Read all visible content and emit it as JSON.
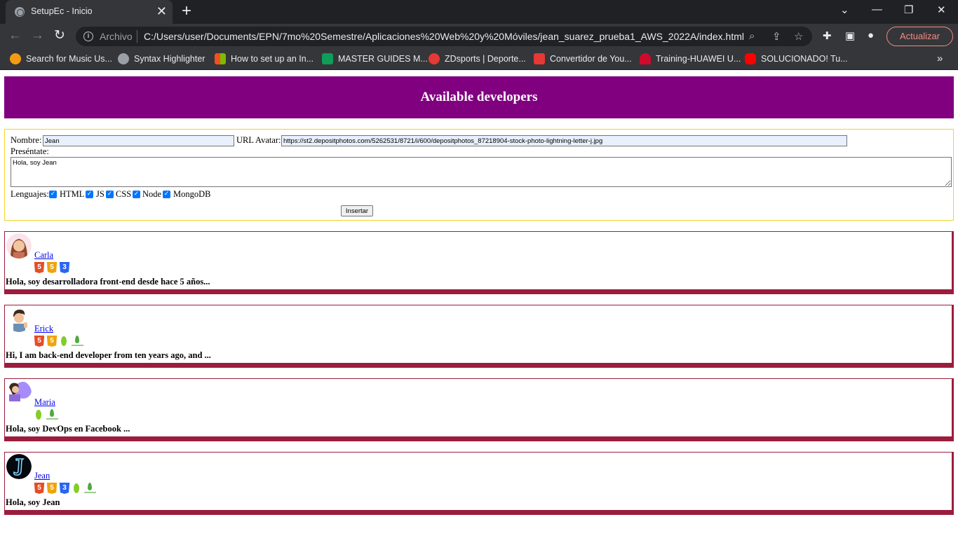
{
  "browser": {
    "tab_title": "SetupEc - Inicio",
    "tab_close": "✕",
    "new_tab": "+",
    "window_controls": {
      "dropdown": "⌄",
      "minimize": "—",
      "restore": "❐",
      "close": "✕"
    },
    "nav": {
      "back": "←",
      "forward": "→",
      "reload": "↻"
    },
    "omnibox": {
      "scheme_label": "Archivo",
      "url": "C:/Users/user/Documents/EPN/7mo%20Semestre/Aplicaciones%20Web%20y%20Móviles/jean_suarez_prueba1_AWS_2022A/index.html"
    },
    "update_button": "Actualizar",
    "bookmarks": [
      {
        "label": "Search for Music Us...",
        "icon": "music-search-icon",
        "color": "#f39c12"
      },
      {
        "label": "Syntax Highlighter",
        "icon": "globe-icon",
        "color": "#9aa0a6"
      },
      {
        "label": "How to set up an In...",
        "icon": "microsoft-icon",
        "color": "#f25022"
      },
      {
        "label": "MASTER GUIDES M...",
        "icon": "sheets-icon",
        "color": "#0f9d58"
      },
      {
        "label": "ZDsports | Deporte...",
        "icon": "zdsports-icon",
        "color": "#e53935"
      },
      {
        "label": "Convertidor de You...",
        "icon": "converter-icon",
        "color": "#e53935"
      },
      {
        "label": "Training-HUAWEI U...",
        "icon": "huawei-icon",
        "color": "#cf0a2c"
      },
      {
        "label": "SOLUCIONADO! Tu...",
        "icon": "youtube-icon",
        "color": "#ff0000"
      }
    ],
    "bookmarks_more": "»"
  },
  "page": {
    "header_title": "Available developers",
    "form": {
      "name_label": "Nombre:",
      "name_value": "Jean",
      "avatar_label": "URL Avatar:",
      "avatar_value": "https://st2.depositphotos.com/5262531/8721/i/600/depositphotos_87218904-stock-photo-lightning-letter-j.jpg",
      "intro_label": "Preséntate:",
      "intro_value": "Hola, soy Jean",
      "languages_label": "Lenguajes:",
      "languages": [
        "HTML",
        "JS",
        "CSS",
        "Node",
        "MongoDB"
      ],
      "submit_label": "Insertar"
    },
    "developers": [
      {
        "name": "Carla",
        "langs": [
          "html",
          "js",
          "css"
        ],
        "description": "Hola, soy desarrolladora front-end desde hace 5 años..."
      },
      {
        "name": "Erick",
        "langs": [
          "html",
          "js",
          "node",
          "mongo"
        ],
        "description": "Hi, I am back-end developer from ten years ago, and ..."
      },
      {
        "name": "Maria",
        "langs": [
          "node",
          "mongo"
        ],
        "description": "Hola, soy DevOps en Facebook ..."
      },
      {
        "name": "Jean",
        "langs": [
          "html",
          "js",
          "css",
          "node",
          "mongo"
        ],
        "description": "Hola, soy Jean"
      }
    ],
    "lang_glyphs": {
      "html": "5",
      "js": "5",
      "css": "3"
    }
  }
}
